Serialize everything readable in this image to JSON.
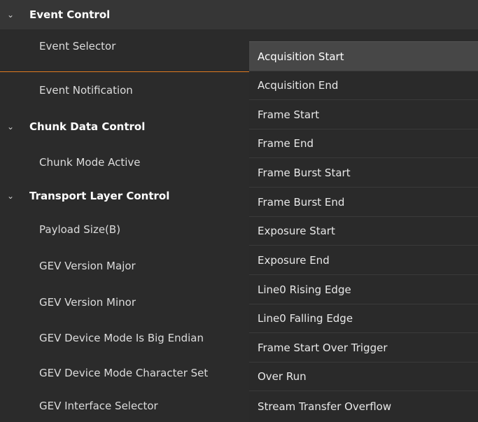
{
  "tree": {
    "categories": {
      "event_control": "Event Control",
      "chunk_data_control": "Chunk Data Control",
      "transport_layer_control": "Transport Layer Control"
    },
    "properties": {
      "event_selector": "Event Selector",
      "event_notification": "Event Notification",
      "chunk_mode_active": "Chunk Mode Active",
      "payload_size": "Payload Size(B)",
      "gev_version_major": "GEV Version Major",
      "gev_version_minor": "GEV Version Minor",
      "gev_device_mode_big_endian": "GEV Device Mode Is Big Endian",
      "gev_device_mode_charset": "GEV Device Mode Character Set",
      "gev_interface_selector": "GEV Interface Selector"
    },
    "chevron": "⌄"
  },
  "dropdown": {
    "selected": "Acquisition Start",
    "options": [
      "Acquisition Start",
      "Acquisition End",
      "Frame Start",
      "Frame End",
      "Frame Burst Start",
      "Frame Burst End",
      "Exposure Start",
      "Exposure End",
      "Line0 Rising Edge",
      "Line0 Falling Edge",
      "Frame Start Over Trigger",
      "Over Run",
      "Stream Transfer Overflow"
    ]
  },
  "colors": {
    "background": "#2b2b2b",
    "category_background": "#363636",
    "selection_accent": "#e07a1f",
    "active_option": "#474747"
  }
}
